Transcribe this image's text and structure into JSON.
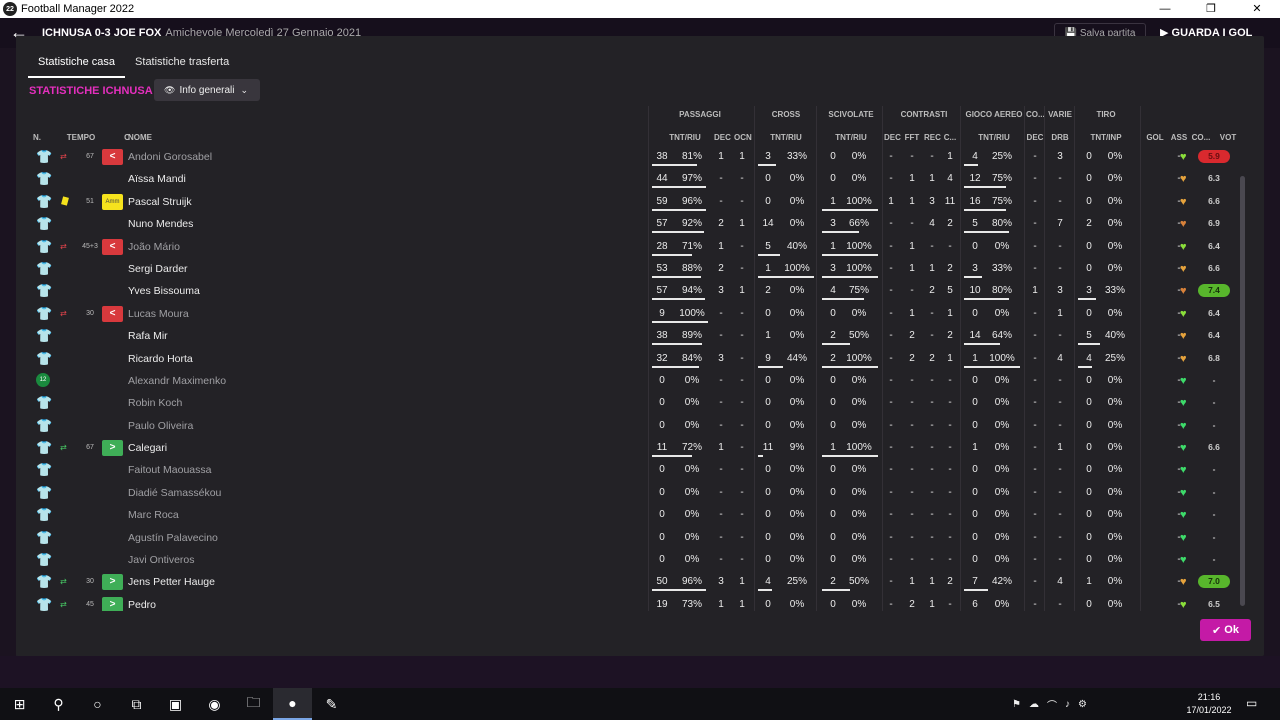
{
  "window": {
    "title": "Football Manager 2022",
    "app_icon": "22",
    "controls": [
      "—",
      "❐",
      "✕"
    ]
  },
  "app_header": {
    "match": "ICHNUSA 0-3 JOE FOX",
    "sub": "Amichevole  Mercoledì 27 Gennaio 2021",
    "save_label": "Salva partita",
    "watch_label": "GUARDA I GOL"
  },
  "tabs": [
    {
      "label": "Statistiche casa"
    },
    {
      "label": "Statistiche trasferta"
    }
  ],
  "section_title": "STATISTICHE ICHNUSA",
  "view_dropdown": {
    "label": "Info generali"
  },
  "groups": [
    "PASSAGGI",
    "CROSS",
    "SCIVOLATE",
    "CONTRASTI",
    "GIOCO AEREO",
    "CO...",
    "VARIE",
    "TIRO"
  ],
  "columns": [
    "N.",
    "TEMPO",
    "C",
    "NOME",
    "TNT/RIU",
    "DEC",
    "OCN",
    "TNT/RIU",
    "TNT/RIU",
    "DEC",
    "FFT",
    "REC",
    "C...",
    "TNT/RIU",
    "DEC",
    "DRB",
    "TNT/INP",
    "GOL",
    "ASS",
    "CO...",
    "VOT"
  ],
  "players": [
    {
      "name": "Andoni Gorosabel",
      "bench": true,
      "sub": "out",
      "minute": "67",
      "badge": "out",
      "pass_t": "38",
      "pass_p": "81%",
      "pass_pct": 81,
      "dec": "1",
      "ocn": "1",
      "cross_t": "3",
      "cross_p": "33%",
      "cross_pct": 33,
      "sciv_t": "0",
      "sciv_p": "0%",
      "sciv_pct": 0,
      "c_dec": "-",
      "c_fft": "-",
      "c_rec": "-",
      "c_c": "1",
      "aer_t": "4",
      "aer_p": "25%",
      "aer_pct": 25,
      "co_dec": "-",
      "drb": "3",
      "shot_t": "0",
      "shot_p": "0%",
      "shot_pct": 0,
      "gol": "",
      "ass": "-",
      "heart": "#8be03a",
      "vot": "5.9",
      "vot_style": "low"
    },
    {
      "name": "Aïssa Mandi",
      "bench": false,
      "sub": "",
      "minute": "",
      "badge": "",
      "pass_t": "44",
      "pass_p": "97%",
      "pass_pct": 97,
      "dec": "-",
      "ocn": "-",
      "cross_t": "0",
      "cross_p": "0%",
      "cross_pct": 0,
      "sciv_t": "0",
      "sciv_p": "0%",
      "sciv_pct": 0,
      "c_dec": "-",
      "c_fft": "1",
      "c_rec": "1",
      "c_c": "4",
      "aer_t": "12",
      "aer_p": "75%",
      "aer_pct": 75,
      "co_dec": "-",
      "drb": "-",
      "shot_t": "0",
      "shot_p": "0%",
      "shot_pct": 0,
      "gol": "",
      "ass": "-",
      "heart": "#e6a33c",
      "vot": "6.3",
      "vot_style": ""
    },
    {
      "name": "Pascal Struijk",
      "bench": false,
      "sub": "card",
      "minute": "51",
      "badge": "card",
      "pass_t": "59",
      "pass_p": "96%",
      "pass_pct": 96,
      "dec": "-",
      "ocn": "-",
      "cross_t": "0",
      "cross_p": "0%",
      "cross_pct": 0,
      "sciv_t": "1",
      "sciv_p": "100%",
      "sciv_pct": 100,
      "c_dec": "1",
      "c_fft": "1",
      "c_rec": "3",
      "c_c": "11",
      "aer_t": "16",
      "aer_p": "75%",
      "aer_pct": 75,
      "co_dec": "-",
      "drb": "-",
      "shot_t": "0",
      "shot_p": "0%",
      "shot_pct": 0,
      "gol": "",
      "ass": "-",
      "heart": "#e6a33c",
      "vot": "6.6",
      "vot_style": ""
    },
    {
      "name": "Nuno Mendes",
      "bench": false,
      "sub": "",
      "minute": "",
      "badge": "",
      "pass_t": "57",
      "pass_p": "92%",
      "pass_pct": 92,
      "dec": "2",
      "ocn": "1",
      "cross_t": "14",
      "cross_p": "0%",
      "cross_pct": 0,
      "sciv_t": "3",
      "sciv_p": "66%",
      "sciv_pct": 66,
      "c_dec": "-",
      "c_fft": "-",
      "c_rec": "4",
      "c_c": "2",
      "aer_t": "5",
      "aer_p": "80%",
      "aer_pct": 80,
      "co_dec": "-",
      "drb": "7",
      "shot_t": "2",
      "shot_p": "0%",
      "shot_pct": 0,
      "gol": "",
      "ass": "-",
      "heart": "#d9823a",
      "vot": "6.9",
      "vot_style": ""
    },
    {
      "name": "João Mário",
      "bench": true,
      "sub": "out",
      "minute": "45+3",
      "badge": "out",
      "pass_t": "28",
      "pass_p": "71%",
      "pass_pct": 71,
      "dec": "1",
      "ocn": "-",
      "cross_t": "5",
      "cross_p": "40%",
      "cross_pct": 40,
      "sciv_t": "1",
      "sciv_p": "100%",
      "sciv_pct": 100,
      "c_dec": "-",
      "c_fft": "1",
      "c_rec": "-",
      "c_c": "-",
      "aer_t": "0",
      "aer_p": "0%",
      "aer_pct": 0,
      "co_dec": "-",
      "drb": "-",
      "shot_t": "0",
      "shot_p": "0%",
      "shot_pct": 0,
      "gol": "",
      "ass": "-",
      "heart": "#8be03a",
      "vot": "6.4",
      "vot_style": ""
    },
    {
      "name": "Sergi Darder",
      "bench": false,
      "sub": "",
      "minute": "",
      "badge": "",
      "pass_t": "53",
      "pass_p": "88%",
      "pass_pct": 88,
      "dec": "2",
      "ocn": "-",
      "cross_t": "1",
      "cross_p": "100%",
      "cross_pct": 100,
      "sciv_t": "3",
      "sciv_p": "100%",
      "sciv_pct": 100,
      "c_dec": "-",
      "c_fft": "1",
      "c_rec": "1",
      "c_c": "2",
      "aer_t": "3",
      "aer_p": "33%",
      "aer_pct": 33,
      "co_dec": "-",
      "drb": "-",
      "shot_t": "0",
      "shot_p": "0%",
      "shot_pct": 0,
      "gol": "",
      "ass": "-",
      "heart": "#e6a33c",
      "vot": "6.6",
      "vot_style": ""
    },
    {
      "name": "Yves Bissouma",
      "bench": false,
      "sub": "",
      "minute": "",
      "badge": "",
      "pass_t": "57",
      "pass_p": "94%",
      "pass_pct": 94,
      "dec": "3",
      "ocn": "1",
      "cross_t": "2",
      "cross_p": "0%",
      "cross_pct": 0,
      "sciv_t": "4",
      "sciv_p": "75%",
      "sciv_pct": 75,
      "c_dec": "-",
      "c_fft": "-",
      "c_rec": "2",
      "c_c": "5",
      "aer_t": "10",
      "aer_p": "80%",
      "aer_pct": 80,
      "co_dec": "1",
      "drb": "3",
      "shot_t": "3",
      "shot_p": "33%",
      "shot_pct": 33,
      "gol": "",
      "ass": "-",
      "heart": "#d9823a",
      "vot": "7.4",
      "vot_style": "high"
    },
    {
      "name": "Lucas Moura",
      "bench": true,
      "sub": "out",
      "minute": "30",
      "badge": "out",
      "pass_t": "9",
      "pass_p": "100%",
      "pass_pct": 100,
      "dec": "-",
      "ocn": "-",
      "cross_t": "0",
      "cross_p": "0%",
      "cross_pct": 0,
      "sciv_t": "0",
      "sciv_p": "0%",
      "sciv_pct": 0,
      "c_dec": "-",
      "c_fft": "1",
      "c_rec": "-",
      "c_c": "1",
      "aer_t": "0",
      "aer_p": "0%",
      "aer_pct": 0,
      "co_dec": "-",
      "drb": "1",
      "shot_t": "0",
      "shot_p": "0%",
      "shot_pct": 0,
      "gol": "",
      "ass": "-",
      "heart": "#8be03a",
      "vot": "6.4",
      "vot_style": ""
    },
    {
      "name": "Rafa Mir",
      "bench": false,
      "sub": "",
      "minute": "",
      "badge": "",
      "pass_t": "38",
      "pass_p": "89%",
      "pass_pct": 89,
      "dec": "-",
      "ocn": "-",
      "cross_t": "1",
      "cross_p": "0%",
      "cross_pct": 0,
      "sciv_t": "2",
      "sciv_p": "50%",
      "sciv_pct": 50,
      "c_dec": "-",
      "c_fft": "2",
      "c_rec": "-",
      "c_c": "2",
      "aer_t": "14",
      "aer_p": "64%",
      "aer_pct": 64,
      "co_dec": "-",
      "drb": "-",
      "shot_t": "5",
      "shot_p": "40%",
      "shot_pct": 40,
      "gol": "",
      "ass": "-",
      "heart": "#e6a33c",
      "vot": "6.4",
      "vot_style": ""
    },
    {
      "name": "Ricardo Horta",
      "bench": false,
      "sub": "",
      "minute": "",
      "badge": "",
      "pass_t": "32",
      "pass_p": "84%",
      "pass_pct": 84,
      "dec": "3",
      "ocn": "-",
      "cross_t": "9",
      "cross_p": "44%",
      "cross_pct": 44,
      "sciv_t": "2",
      "sciv_p": "100%",
      "sciv_pct": 100,
      "c_dec": "-",
      "c_fft": "2",
      "c_rec": "2",
      "c_c": "1",
      "aer_t": "1",
      "aer_p": "100%",
      "aer_pct": 100,
      "co_dec": "-",
      "drb": "4",
      "shot_t": "4",
      "shot_p": "25%",
      "shot_pct": 25,
      "gol": "",
      "ass": "-",
      "heart": "#e6a33c",
      "vot": "6.8",
      "vot_style": ""
    },
    {
      "name": "Alexandr Maximenko",
      "bench": true,
      "gk": true,
      "sub": "",
      "minute": "",
      "badge": "",
      "pass_t": "0",
      "pass_p": "0%",
      "pass_pct": 0,
      "dec": "-",
      "ocn": "-",
      "cross_t": "0",
      "cross_p": "0%",
      "cross_pct": 0,
      "sciv_t": "0",
      "sciv_p": "0%",
      "sciv_pct": 0,
      "c_dec": "-",
      "c_fft": "-",
      "c_rec": "-",
      "c_c": "-",
      "aer_t": "0",
      "aer_p": "0%",
      "aer_pct": 0,
      "co_dec": "-",
      "drb": "-",
      "shot_t": "0",
      "shot_p": "0%",
      "shot_pct": 0,
      "gol": "",
      "ass": "-",
      "heart": "#3ddc6a",
      "vot": "-",
      "vot_style": ""
    },
    {
      "name": "Robin Koch",
      "bench": true,
      "sub": "",
      "minute": "",
      "badge": "",
      "pass_t": "0",
      "pass_p": "0%",
      "pass_pct": 0,
      "dec": "-",
      "ocn": "-",
      "cross_t": "0",
      "cross_p": "0%",
      "cross_pct": 0,
      "sciv_t": "0",
      "sciv_p": "0%",
      "sciv_pct": 0,
      "c_dec": "-",
      "c_fft": "-",
      "c_rec": "-",
      "c_c": "-",
      "aer_t": "0",
      "aer_p": "0%",
      "aer_pct": 0,
      "co_dec": "-",
      "drb": "-",
      "shot_t": "0",
      "shot_p": "0%",
      "shot_pct": 0,
      "gol": "",
      "ass": "-",
      "heart": "#3ddc6a",
      "vot": "-",
      "vot_style": ""
    },
    {
      "name": "Paulo Oliveira",
      "bench": true,
      "sub": "",
      "minute": "",
      "badge": "",
      "pass_t": "0",
      "pass_p": "0%",
      "pass_pct": 0,
      "dec": "-",
      "ocn": "-",
      "cross_t": "0",
      "cross_p": "0%",
      "cross_pct": 0,
      "sciv_t": "0",
      "sciv_p": "0%",
      "sciv_pct": 0,
      "c_dec": "-",
      "c_fft": "-",
      "c_rec": "-",
      "c_c": "-",
      "aer_t": "0",
      "aer_p": "0%",
      "aer_pct": 0,
      "co_dec": "-",
      "drb": "-",
      "shot_t": "0",
      "shot_p": "0%",
      "shot_pct": 0,
      "gol": "",
      "ass": "-",
      "heart": "#3ddc6a",
      "vot": "-",
      "vot_style": ""
    },
    {
      "name": "Calegari",
      "bench": false,
      "sub": "in",
      "minute": "67",
      "badge": "in",
      "pass_t": "11",
      "pass_p": "72%",
      "pass_pct": 72,
      "dec": "1",
      "ocn": "-",
      "cross_t": "11",
      "cross_p": "9%",
      "cross_pct": 9,
      "sciv_t": "1",
      "sciv_p": "100%",
      "sciv_pct": 100,
      "c_dec": "-",
      "c_fft": "-",
      "c_rec": "-",
      "c_c": "-",
      "aer_t": "1",
      "aer_p": "0%",
      "aer_pct": 0,
      "co_dec": "-",
      "drb": "1",
      "shot_t": "0",
      "shot_p": "0%",
      "shot_pct": 0,
      "gol": "",
      "ass": "-",
      "heart": "#3ddc6a",
      "vot": "6.6",
      "vot_style": ""
    },
    {
      "name": "Faitout Maouassa",
      "bench": true,
      "sub": "",
      "minute": "",
      "badge": "",
      "pass_t": "0",
      "pass_p": "0%",
      "pass_pct": 0,
      "dec": "-",
      "ocn": "-",
      "cross_t": "0",
      "cross_p": "0%",
      "cross_pct": 0,
      "sciv_t": "0",
      "sciv_p": "0%",
      "sciv_pct": 0,
      "c_dec": "-",
      "c_fft": "-",
      "c_rec": "-",
      "c_c": "-",
      "aer_t": "0",
      "aer_p": "0%",
      "aer_pct": 0,
      "co_dec": "-",
      "drb": "-",
      "shot_t": "0",
      "shot_p": "0%",
      "shot_pct": 0,
      "gol": "",
      "ass": "-",
      "heart": "#3ddc6a",
      "vot": "-",
      "vot_style": ""
    },
    {
      "name": "Diadié Samassékou",
      "bench": true,
      "sub": "",
      "minute": "",
      "badge": "",
      "pass_t": "0",
      "pass_p": "0%",
      "pass_pct": 0,
      "dec": "-",
      "ocn": "-",
      "cross_t": "0",
      "cross_p": "0%",
      "cross_pct": 0,
      "sciv_t": "0",
      "sciv_p": "0%",
      "sciv_pct": 0,
      "c_dec": "-",
      "c_fft": "-",
      "c_rec": "-",
      "c_c": "-",
      "aer_t": "0",
      "aer_p": "0%",
      "aer_pct": 0,
      "co_dec": "-",
      "drb": "-",
      "shot_t": "0",
      "shot_p": "0%",
      "shot_pct": 0,
      "gol": "",
      "ass": "-",
      "heart": "#3ddc6a",
      "vot": "-",
      "vot_style": ""
    },
    {
      "name": "Marc Roca",
      "bench": true,
      "sub": "",
      "minute": "",
      "badge": "",
      "pass_t": "0",
      "pass_p": "0%",
      "pass_pct": 0,
      "dec": "-",
      "ocn": "-",
      "cross_t": "0",
      "cross_p": "0%",
      "cross_pct": 0,
      "sciv_t": "0",
      "sciv_p": "0%",
      "sciv_pct": 0,
      "c_dec": "-",
      "c_fft": "-",
      "c_rec": "-",
      "c_c": "-",
      "aer_t": "0",
      "aer_p": "0%",
      "aer_pct": 0,
      "co_dec": "-",
      "drb": "-",
      "shot_t": "0",
      "shot_p": "0%",
      "shot_pct": 0,
      "gol": "",
      "ass": "-",
      "heart": "#3ddc6a",
      "vot": "-",
      "vot_style": ""
    },
    {
      "name": "Agustín Palavecino",
      "bench": true,
      "sub": "",
      "minute": "",
      "badge": "",
      "pass_t": "0",
      "pass_p": "0%",
      "pass_pct": 0,
      "dec": "-",
      "ocn": "-",
      "cross_t": "0",
      "cross_p": "0%",
      "cross_pct": 0,
      "sciv_t": "0",
      "sciv_p": "0%",
      "sciv_pct": 0,
      "c_dec": "-",
      "c_fft": "-",
      "c_rec": "-",
      "c_c": "-",
      "aer_t": "0",
      "aer_p": "0%",
      "aer_pct": 0,
      "co_dec": "-",
      "drb": "-",
      "shot_t": "0",
      "shot_p": "0%",
      "shot_pct": 0,
      "gol": "",
      "ass": "-",
      "heart": "#3ddc6a",
      "vot": "-",
      "vot_style": ""
    },
    {
      "name": "Javi Ontiveros",
      "bench": true,
      "sub": "",
      "minute": "",
      "badge": "",
      "pass_t": "0",
      "pass_p": "0%",
      "pass_pct": 0,
      "dec": "-",
      "ocn": "-",
      "cross_t": "0",
      "cross_p": "0%",
      "cross_pct": 0,
      "sciv_t": "0",
      "sciv_p": "0%",
      "sciv_pct": 0,
      "c_dec": "-",
      "c_fft": "-",
      "c_rec": "-",
      "c_c": "-",
      "aer_t": "0",
      "aer_p": "0%",
      "aer_pct": 0,
      "co_dec": "-",
      "drb": "-",
      "shot_t": "0",
      "shot_p": "0%",
      "shot_pct": 0,
      "gol": "",
      "ass": "-",
      "heart": "#3ddc6a",
      "vot": "-",
      "vot_style": ""
    },
    {
      "name": "Jens Petter Hauge",
      "bench": false,
      "sub": "in",
      "minute": "30",
      "badge": "in",
      "pass_t": "50",
      "pass_p": "96%",
      "pass_pct": 96,
      "dec": "3",
      "ocn": "1",
      "cross_t": "4",
      "cross_p": "25%",
      "cross_pct": 25,
      "sciv_t": "2",
      "sciv_p": "50%",
      "sciv_pct": 50,
      "c_dec": "-",
      "c_fft": "1",
      "c_rec": "1",
      "c_c": "2",
      "aer_t": "7",
      "aer_p": "42%",
      "aer_pct": 42,
      "co_dec": "-",
      "drb": "4",
      "shot_t": "1",
      "shot_p": "0%",
      "shot_pct": 0,
      "gol": "",
      "ass": "-",
      "heart": "#e6a33c",
      "vot": "7.0",
      "vot_style": "high"
    },
    {
      "name": "Pedro",
      "bench": false,
      "sub": "in",
      "minute": "45",
      "badge": "in",
      "pass_t": "19",
      "pass_p": "73%",
      "pass_pct": 73,
      "dec": "1",
      "ocn": "1",
      "cross_t": "0",
      "cross_p": "0%",
      "cross_pct": 0,
      "sciv_t": "0",
      "sciv_p": "0%",
      "sciv_pct": 0,
      "c_dec": "-",
      "c_fft": "2",
      "c_rec": "1",
      "c_c": "-",
      "aer_t": "6",
      "aer_p": "0%",
      "aer_pct": 0,
      "co_dec": "-",
      "drb": "-",
      "shot_t": "0",
      "shot_p": "0%",
      "shot_pct": 0,
      "gol": "",
      "ass": "-",
      "heart": "#8be03a",
      "vot": "6.5",
      "vot_style": ""
    }
  ],
  "badges": {
    "out": "<",
    "in": ">",
    "card": "Amm"
  },
  "ok_label": "Ok",
  "taskbar": {
    "icons": [
      "windows-icon",
      "search-icon",
      "cortana-icon",
      "task-view-icon",
      "remote-desktop-icon",
      "chrome-icon",
      "file-explorer-icon",
      "football-manager-icon",
      "paint-icon"
    ],
    "time": "21:16",
    "date": "17/01/2022"
  },
  "colors": {
    "accent": "#c41aa6",
    "title": "#e52fbe",
    "shirt": "#ee5a24"
  }
}
